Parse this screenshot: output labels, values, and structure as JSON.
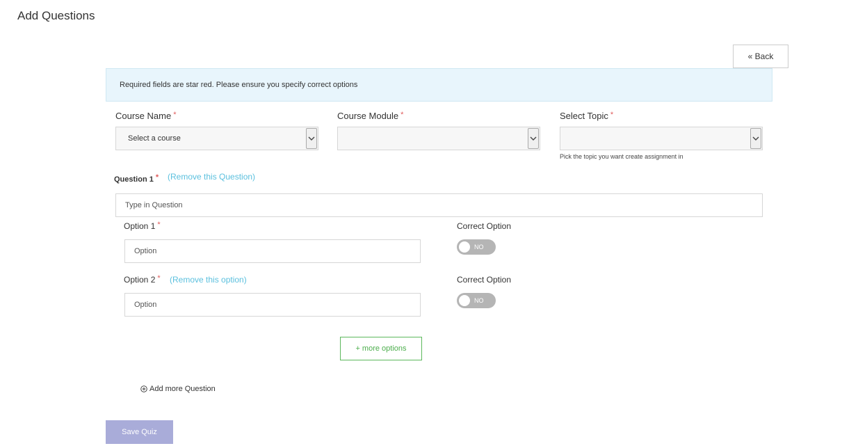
{
  "header": {
    "title": "Add Questions",
    "back_label": "« Back"
  },
  "notice": "Required fields are star red. Please ensure you specify correct options",
  "required_mark": "*",
  "selects": {
    "course": {
      "label": "Course Name",
      "value": "Select a course"
    },
    "module": {
      "label": "Course Module",
      "value": ""
    },
    "topic": {
      "label": "Select Topic",
      "value": "",
      "help": "Pick the topic you want create assignment in"
    }
  },
  "question": {
    "label": "Question 1",
    "remove_label": "(Remove this Question)",
    "placeholder": "Type in Question",
    "options": [
      {
        "label": "Option 1",
        "placeholder": "Option",
        "remove_label": "",
        "correct_label": "Correct Option",
        "toggle_state": "NO"
      },
      {
        "label": "Option 2",
        "placeholder": "Option",
        "remove_label": "(Remove this option)",
        "correct_label": "Correct Option",
        "toggle_state": "NO"
      }
    ]
  },
  "more_options_label": "+ more options",
  "add_question_label": "Add more Question",
  "save_label": "Save Quiz",
  "icons": {
    "select_arrow": "chevron-down-icon",
    "add_question": "plus-circle-icon"
  },
  "colors": {
    "required": "#e05b5b",
    "link": "#5bc0de",
    "info_bg": "#e8f5fc",
    "more_options": "#5cb85c",
    "save_button": "#a9acd9",
    "toggle_off": "#b5b5b5"
  }
}
